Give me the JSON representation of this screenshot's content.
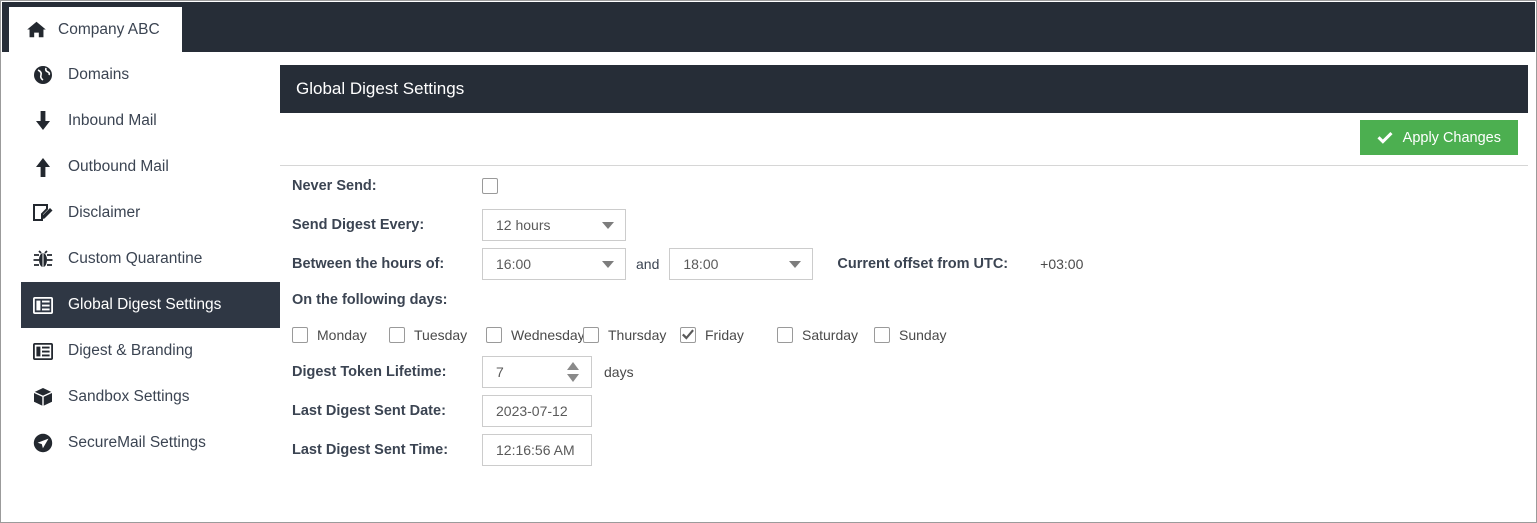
{
  "tab": {
    "label": "Company ABC",
    "icon": "home-icon"
  },
  "sidebar": {
    "items": [
      {
        "label": "Domains",
        "icon": "globe-icon",
        "active": false
      },
      {
        "label": "Inbound Mail",
        "icon": "arrow-down-icon",
        "active": false
      },
      {
        "label": "Outbound Mail",
        "icon": "arrow-up-icon",
        "active": false
      },
      {
        "label": "Disclaimer",
        "icon": "edit-note-icon",
        "active": false
      },
      {
        "label": "Custom Quarantine",
        "icon": "bug-icon",
        "active": false
      },
      {
        "label": "Global Digest Settings",
        "icon": "list-panel-icon",
        "active": true
      },
      {
        "label": "Digest & Branding",
        "icon": "list-panel-icon",
        "active": false
      },
      {
        "label": "Sandbox Settings",
        "icon": "box-icon",
        "active": false
      },
      {
        "label": "SecureMail Settings",
        "icon": "paper-plane-icon",
        "active": false
      }
    ]
  },
  "header": {
    "title": "Global Digest Settings"
  },
  "toolbar": {
    "apply_label": "Apply Changes",
    "apply_icon": "check-icon",
    "apply_color": "#4caf50"
  },
  "form": {
    "never_send": {
      "label": "Never Send:",
      "checked": false
    },
    "send_digest_every": {
      "label": "Send Digest Every:",
      "value": "12 hours"
    },
    "between_hours": {
      "label": "Between the hours of:",
      "from": "16:00",
      "and": "and",
      "to": "18:00"
    },
    "utc_offset": {
      "label": "Current offset from UTC:",
      "value": "+03:00"
    },
    "days": {
      "label": "On the following days:",
      "items": [
        {
          "label": "Monday",
          "checked": false
        },
        {
          "label": "Tuesday",
          "checked": false
        },
        {
          "label": "Wednesday",
          "checked": false
        },
        {
          "label": "Thursday",
          "checked": false
        },
        {
          "label": "Friday",
          "checked": true
        },
        {
          "label": "Saturday",
          "checked": false
        },
        {
          "label": "Sunday",
          "checked": false
        }
      ]
    },
    "token_lifetime": {
      "label": "Digest Token Lifetime:",
      "value": "7",
      "units": "days"
    },
    "last_sent_date": {
      "label": "Last Digest Sent Date:",
      "value": "2023-07-12"
    },
    "last_sent_time": {
      "label": "Last Digest Sent Time:",
      "value": "12:16:56 AM"
    }
  }
}
